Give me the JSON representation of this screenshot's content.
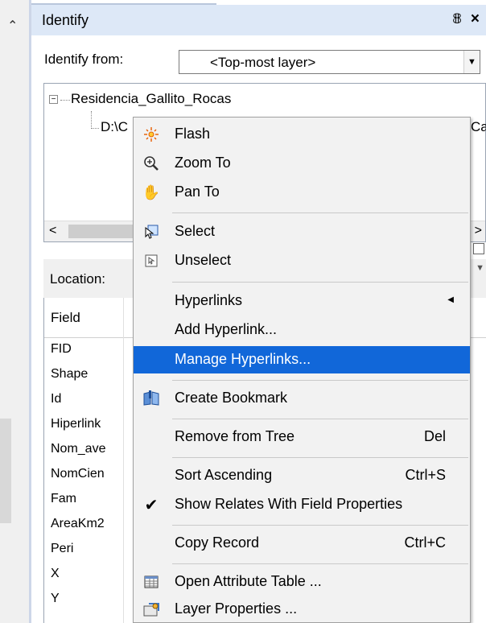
{
  "window": {
    "title": "Identify",
    "pin_icon": "pin-icon",
    "close_label": "×"
  },
  "identify_from": {
    "label": "Identify from:",
    "value": "<Top-most layer>"
  },
  "tree": {
    "root": "Residencia_Gallito_Rocas",
    "child_prefix": "D:\\C",
    "child_suffix": "Ca"
  },
  "location": {
    "label": "Location:"
  },
  "table": {
    "header": "Field",
    "fields": [
      "FID",
      "Shape",
      "Id",
      "Hiperlink",
      "Nom_ave",
      "NomCien",
      "Fam",
      "AreaKm2",
      "Peri",
      "X",
      "Y"
    ]
  },
  "menu": {
    "items": [
      {
        "label": "Flash",
        "icon": "flash-icon"
      },
      {
        "label": "Zoom To",
        "icon": "zoom-icon"
      },
      {
        "label": "Pan To",
        "icon": "pan-hand-icon"
      },
      {
        "label": "Select",
        "icon": "select-icon"
      },
      {
        "label": "Unselect",
        "icon": "unselect-icon"
      },
      {
        "label": "Hyperlinks",
        "icon": "",
        "submenu": true
      },
      {
        "label": "Add Hyperlink...",
        "icon": ""
      },
      {
        "label": "Manage Hyperlinks...",
        "icon": "",
        "highlighted": true
      },
      {
        "label": "Create Bookmark",
        "icon": "bookmark-icon"
      },
      {
        "label": "Remove from Tree",
        "icon": "",
        "shortcut": "Del"
      },
      {
        "label": "Sort Ascending",
        "icon": "",
        "shortcut": "Ctrl+S"
      },
      {
        "label": "Show Relates With Field Properties",
        "icon": "checkmark-icon",
        "checked": true
      },
      {
        "label": "Copy Record",
        "icon": "",
        "shortcut": "Ctrl+C"
      },
      {
        "label": "Open Attribute Table ...",
        "icon": "table-icon"
      },
      {
        "label": "Layer Properties ...",
        "icon": "layer-properties-icon"
      }
    ]
  },
  "colors": {
    "titlebar": "#dde8f7",
    "highlight": "#1167d9",
    "menu_bg": "#f2f2f2"
  }
}
